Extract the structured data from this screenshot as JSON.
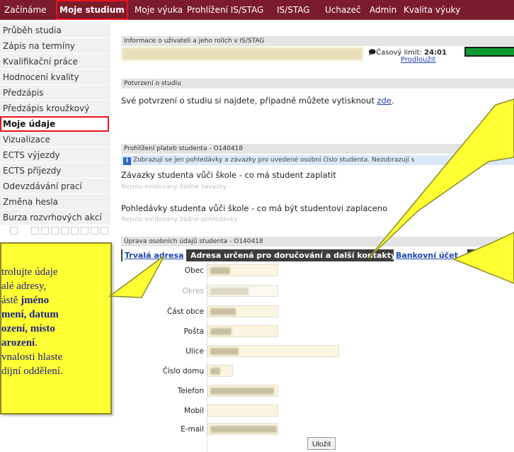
{
  "topnav": {
    "items": [
      "Začínáme",
      "Moje studium",
      "Moje výuka",
      "Prohlížení IS/STAG",
      "IS/STAG",
      "Uchazeč",
      "Admin",
      "Kvalita výuky"
    ]
  },
  "sidebar": {
    "items": [
      "Průběh studia",
      "Zápis na termíny",
      "Kvalifikační práce",
      "Hodnocení kvality",
      "Předzápis",
      "Předzápis kroužkový",
      "Moje údaje",
      "Vizualizace",
      "ECTS výjezdy",
      "ECTS příjezdy",
      "Odevzdávání prací",
      "Změna hesla",
      "Burza rozvrhových akcí"
    ],
    "active": "Moje údaje"
  },
  "user_info": {
    "header": "Informace o uživateli a jeho rolích v IS/STAG",
    "time_limit_label": "Časový limit:",
    "time_limit_value": "24:01",
    "extend_link": "Prodloužit"
  },
  "confirmation": {
    "header": "Potvrzení o studiu",
    "text": "Své potvrzení o studiu si najdete, případně můžete vytisknout",
    "link": "zde",
    "tail": "."
  },
  "payments": {
    "header": "Prohlížení plateb studenta - O140418",
    "info": "Zobrazují se jen pohledávky a závazky pro uvedené osobní číslo studenta. Nezobrazují s",
    "obligations_title": "Závazky studenta vůči škole - co má student zaplatit",
    "obligations_empty": "Nejsou evidovány žádné závazky",
    "receivables_title": "Pohledávky studenta vůči škole - co má být studentovi zaplaceno",
    "receivables_empty": "Nejsou evidovány žádné pohledávky"
  },
  "personal": {
    "header": "Úprava osobních údajů studenta - O140418",
    "tabs": [
      "Trvalá adresa",
      "Adresa určená pro doručování a další kontakty",
      "Bankovní účet"
    ],
    "active_tab": "Adresa určená pro doručování a další kontakty",
    "fields": [
      "Obec",
      "Okres",
      "Část obce",
      "Pošta",
      "Ulice",
      "Číslo domu",
      "Telefon",
      "Mobil",
      "E-mail"
    ],
    "save_button": "Uložit"
  },
  "callout": {
    "line1": "trolujte údaje",
    "line2": "alé adresy,",
    "line3_prefix": "ástě ",
    "line3_bold": "jméno",
    "line4": "mení, datum",
    "line5": "ození, místo",
    "line6_bold": "arození",
    "line6_tail": ".",
    "line7": "vnalosti hlaste",
    "line8": "dijní oddělení."
  }
}
